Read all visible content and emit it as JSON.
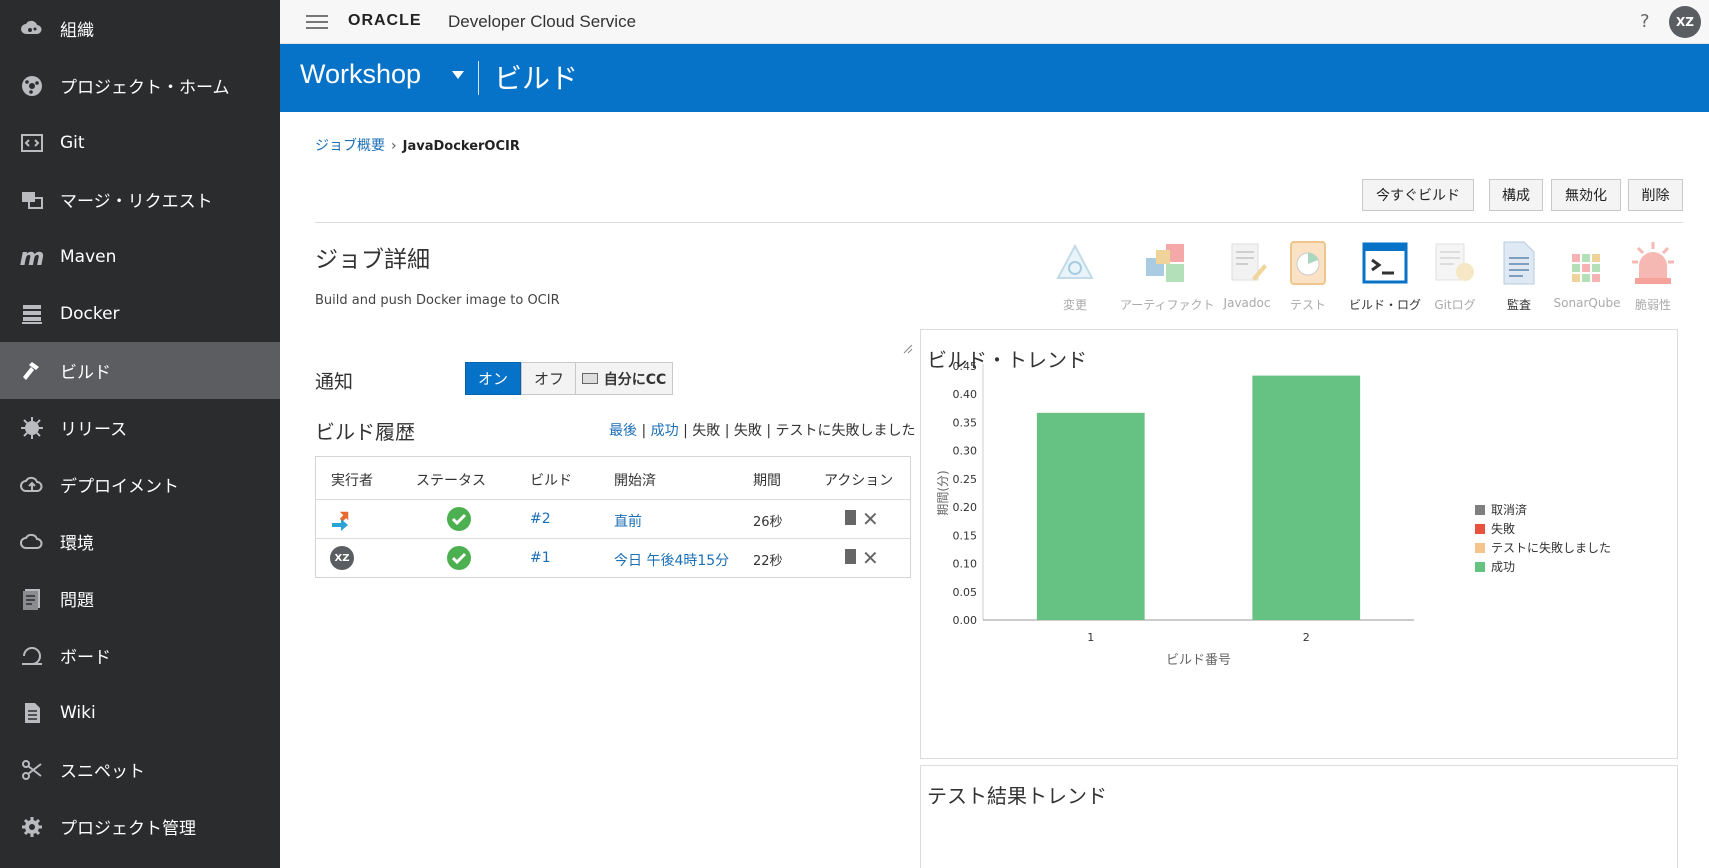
{
  "sidebar": {
    "items": [
      {
        "label": "組織",
        "icon": "organization-icon"
      },
      {
        "label": "プロジェクト・ホーム",
        "icon": "project-home-icon"
      },
      {
        "label": "Git",
        "icon": "git-icon"
      },
      {
        "label": "マージ・リクエスト",
        "icon": "merge-request-icon"
      },
      {
        "label": "Maven",
        "icon": "maven-icon"
      },
      {
        "label": "Docker",
        "icon": "docker-icon"
      },
      {
        "label": "ビルド",
        "icon": "build-icon",
        "active": true
      },
      {
        "label": "リリース",
        "icon": "release-icon"
      },
      {
        "label": "デプロイメント",
        "icon": "deployment-icon"
      },
      {
        "label": "環境",
        "icon": "environment-icon"
      },
      {
        "label": "問題",
        "icon": "issues-icon"
      },
      {
        "label": "ボード",
        "icon": "board-icon"
      },
      {
        "label": "Wiki",
        "icon": "wiki-icon"
      },
      {
        "label": "スニペット",
        "icon": "snippet-icon"
      },
      {
        "label": "プロジェクト管理",
        "icon": "settings-icon"
      }
    ]
  },
  "topbar": {
    "logo": "ORACLE",
    "product": "Developer Cloud Service",
    "help": "?",
    "avatar": "XZ"
  },
  "header": {
    "project": "Workshop",
    "section": "ビルド"
  },
  "breadcrumb": {
    "parent": "ジョブ概要",
    "current": "JavaDockerOCIR"
  },
  "actions": {
    "build_now": "今すぐビルド",
    "configure": "構成",
    "disable": "無効化",
    "delete": "削除"
  },
  "job": {
    "title": "ジョブ詳細",
    "description": "Build and push Docker image to OCIR"
  },
  "tools": [
    {
      "label": "変更",
      "icon": "changes-icon",
      "enabled": false
    },
    {
      "label": "アーティファクト",
      "icon": "artifacts-icon",
      "enabled": false
    },
    {
      "label": "Javadoc",
      "icon": "javadoc-icon",
      "enabled": false
    },
    {
      "label": "テスト",
      "icon": "tests-icon",
      "enabled": false
    },
    {
      "label": "ビルド・ログ",
      "icon": "build-log-icon",
      "enabled": true
    },
    {
      "label": "Gitログ",
      "icon": "git-log-icon",
      "enabled": false
    },
    {
      "label": "監査",
      "icon": "audit-icon",
      "enabled": true
    },
    {
      "label": "SonarQube",
      "icon": "sonarqube-icon",
      "enabled": false
    },
    {
      "label": "脆弱性",
      "icon": "vulnerability-icon",
      "enabled": false
    }
  ],
  "notifications": {
    "label": "通知",
    "on": "オン",
    "off": "オフ",
    "cc": "自分にCC"
  },
  "history": {
    "title": "ビルド履歴",
    "filters": {
      "latest": "最後",
      "success": "成功",
      "failed": "失敗",
      "failed2": "失敗",
      "test_failed": "テストに失敗しました",
      "sep": "|"
    },
    "columns": [
      "実行者",
      "ステータス",
      "ビルド",
      "開始済",
      "期間",
      "アクション"
    ],
    "rows": [
      {
        "executor": "scm-trigger",
        "build": "#2",
        "started": "直前",
        "duration": "26秒"
      },
      {
        "executor": "XZ",
        "build": "#1",
        "started": "今日 午後4時15分",
        "duration": "22秒"
      }
    ]
  },
  "trend": {
    "title": "ビルド・トレンド"
  },
  "chart_data": {
    "type": "bar",
    "categories": [
      "1",
      "2"
    ],
    "series": [
      {
        "name": "成功",
        "values": [
          0.367,
          0.433
        ],
        "color": "#66c283"
      }
    ],
    "legend": [
      {
        "name": "取消済",
        "color": "#7f7f7f"
      },
      {
        "name": "失敗",
        "color": "#e8533d"
      },
      {
        "name": "テストに失敗しました",
        "color": "#f5c48a"
      },
      {
        "name": "成功",
        "color": "#66c283"
      }
    ],
    "yticks": [
      "0.00",
      "0.05",
      "0.10",
      "0.15",
      "0.20",
      "0.25",
      "0.30",
      "0.35",
      "0.40",
      "0.45"
    ],
    "ylim": [
      0,
      0.45
    ],
    "xlabel": "ビルド番号",
    "ylabel": "期間(分)",
    "legend_position": "right"
  },
  "test_trend": {
    "title": "テスト結果トレンド"
  },
  "colors": {
    "sidebar_bg": "#2b2c2e",
    "active_item": "#5b5d60",
    "brand_blue": "#0673c9",
    "link": "#1b6fb7",
    "success": "#4caf50"
  }
}
